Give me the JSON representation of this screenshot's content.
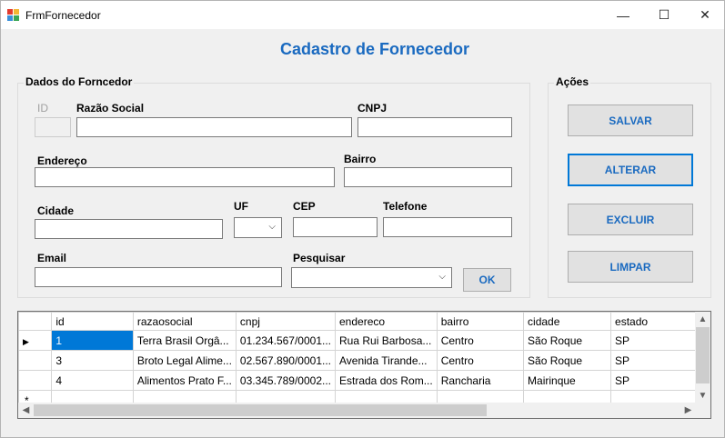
{
  "window": {
    "title": "FrmFornecedor",
    "min_glyph": "—",
    "max_glyph": "☐",
    "close_glyph": "✕"
  },
  "form_title": "Cadastro de Fornecedor",
  "dados": {
    "group_label": "Dados do Forncedor",
    "id_label": "ID",
    "razao_label": "Razão Social",
    "cnpj_label": "CNPJ",
    "endereco_label": "Endereço",
    "bairro_label": "Bairro",
    "cidade_label": "Cidade",
    "uf_label": "UF",
    "cep_label": "CEP",
    "telefone_label": "Telefone",
    "email_label": "Email",
    "pesquisar_label": "Pesquisar",
    "ok_label": "OK"
  },
  "acoes": {
    "group_label": "Ações",
    "salvar": "SALVAR",
    "alterar": "ALTERAR",
    "excluir": "EXCLUIR",
    "limpar": "LIMPAR"
  },
  "grid": {
    "columns": [
      "id",
      "razaosocial",
      "cnpj",
      "endereco",
      "bairro",
      "cidade",
      "estado"
    ],
    "rows": [
      [
        "1",
        "Terra Brasil Orgâ...",
        "01.234.567/0001...",
        "Rua Rui Barbosa...",
        "Centro",
        "São Roque",
        "SP"
      ],
      [
        "3",
        "Broto Legal Alime...",
        "02.567.890/0001...",
        "Avenida Tirande...",
        "Centro",
        "São Roque",
        "SP"
      ],
      [
        "4",
        "Alimentos Prato F...",
        "03.345.789/0002...",
        "Estrada dos Rom...",
        "Rancharia",
        "Mairinque",
        "SP"
      ]
    ],
    "selected_row_marker": "▶",
    "new_row_marker": "*"
  },
  "colors": {
    "accent": "#1a6ac0",
    "selection": "#0078d7"
  }
}
